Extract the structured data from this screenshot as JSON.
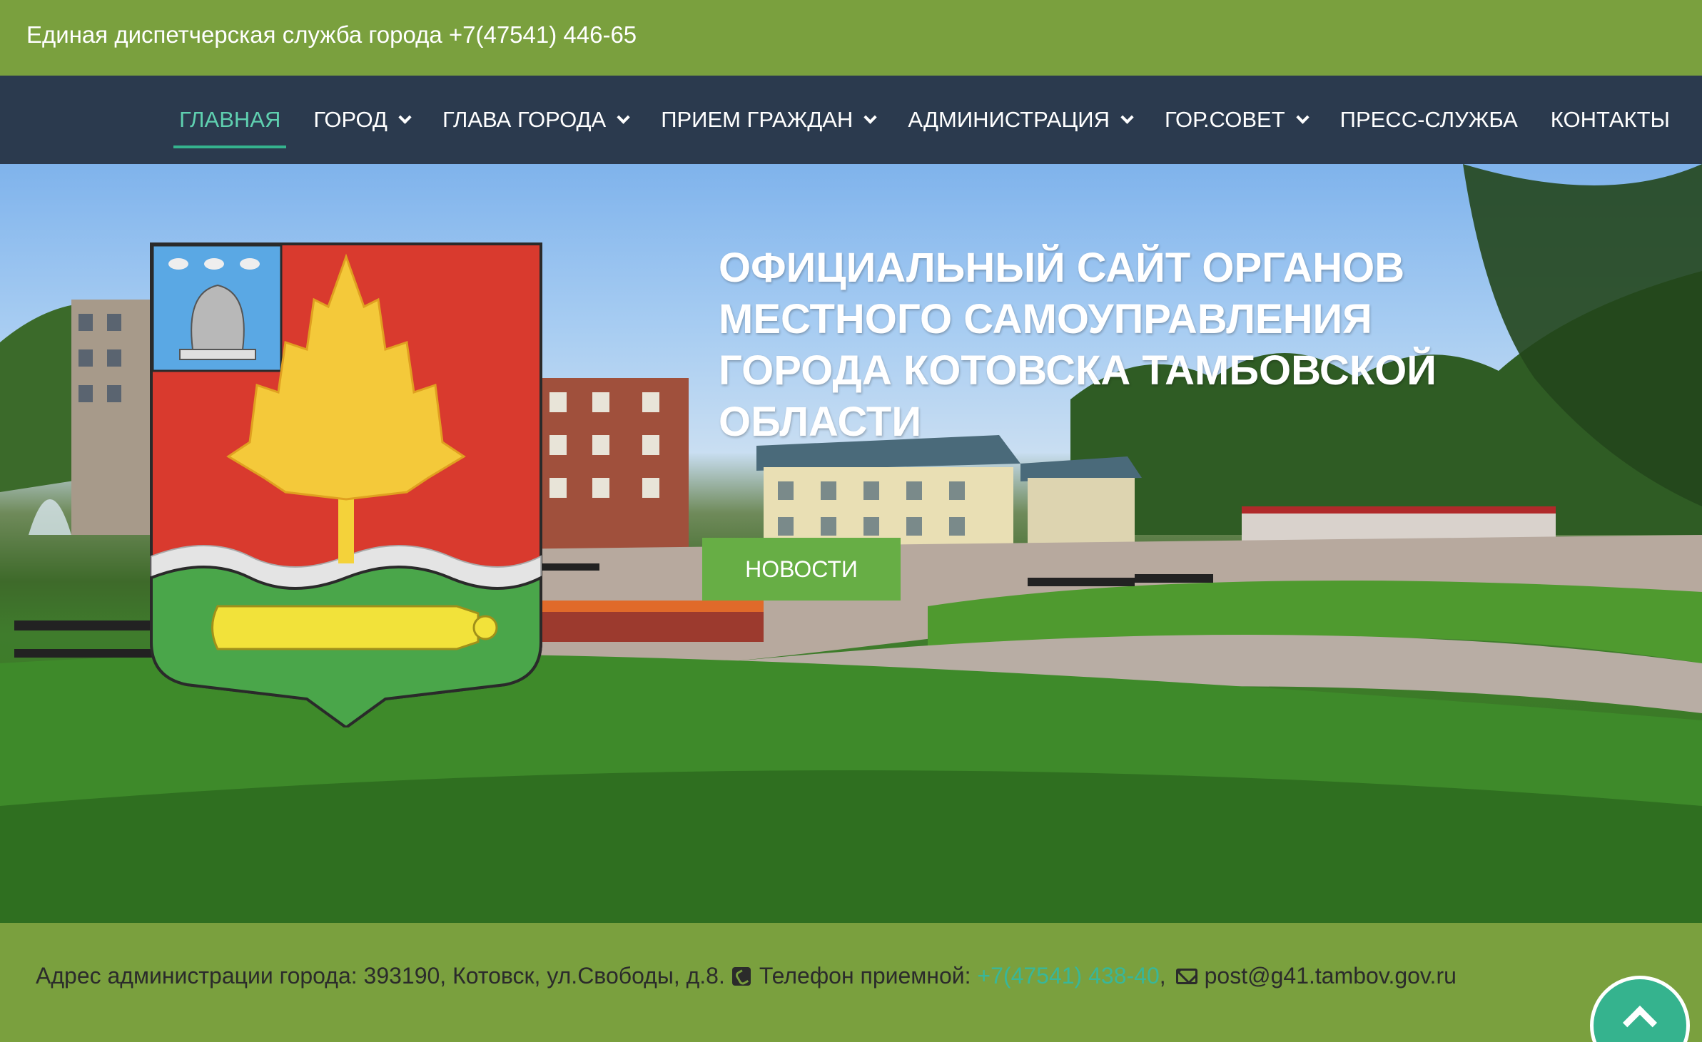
{
  "topbar": {
    "text": "Единая диспетчерская служба города +7(47541) 446-65"
  },
  "nav": {
    "items": [
      {
        "label": "ГЛАВНАЯ",
        "active": true,
        "dropdown": false
      },
      {
        "label": "ГОРОД",
        "active": false,
        "dropdown": true
      },
      {
        "label": "ГЛАВА ГОРОДА",
        "active": false,
        "dropdown": true
      },
      {
        "label": "ПРИЕМ ГРАЖДАН",
        "active": false,
        "dropdown": true
      },
      {
        "label": "АДМИНИСТРАЦИЯ",
        "active": false,
        "dropdown": true
      },
      {
        "label": "ГОР.СОВЕТ",
        "active": false,
        "dropdown": true
      },
      {
        "label": "ПРЕСС-СЛУЖБА",
        "active": false,
        "dropdown": false
      },
      {
        "label": "КОНТАКТЫ",
        "active": false,
        "dropdown": false
      }
    ]
  },
  "hero": {
    "title": "ОФИЦИАЛЬНЫЙ САЙТ ОРГАНОВ МЕСТНОГО САМОУПРАВЛЕНИЯ ГОРОДА КОТОВСКА ТАМБОВСКОЙ ОБЛАСТИ",
    "button_label": "НОВОСТИ"
  },
  "footer": {
    "address": "Адрес администрации города: 393190, Котовск, ул.Свободы, д.8.",
    "phone_label": "Телефон приемной:",
    "phone_value": "+7(47541) 438-40",
    "comma": ",",
    "email": "post@g41.tambov.gov.ru"
  },
  "icons": {
    "phone": "phone-square-icon",
    "mail": "envelope-icon",
    "scroll_top": "chevron-up-icon"
  },
  "colors": {
    "green_bar": "#7aa03e",
    "nav_bg": "#2b3a4e",
    "accent": "#35b38e",
    "button": "#67ae45"
  }
}
